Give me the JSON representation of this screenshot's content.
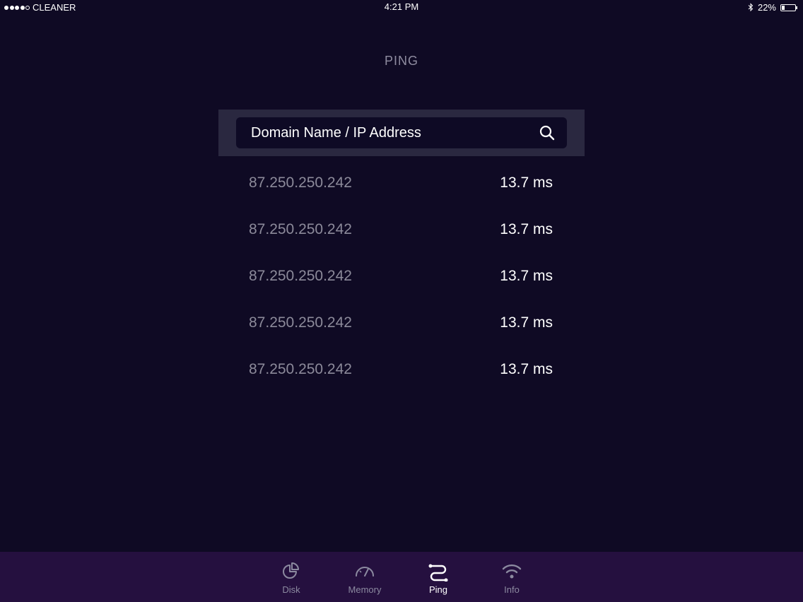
{
  "status_bar": {
    "carrier": "CLEANER",
    "time": "4:21 PM",
    "battery_percent": "22%",
    "battery_level": 0.22,
    "signal_bars_filled": 4,
    "signal_bars_total": 5,
    "icons": [
      "signal-dots-icon",
      "bluetooth-icon",
      "battery-icon"
    ]
  },
  "header": {
    "title": "PING"
  },
  "search": {
    "placeholder": "Domain Name / IP Address",
    "value": "",
    "icon": "search-icon"
  },
  "results": [
    {
      "ip": "87.250.250.242",
      "time": "13.7 ms"
    },
    {
      "ip": "87.250.250.242",
      "time": "13.7 ms"
    },
    {
      "ip": "87.250.250.242",
      "time": "13.7 ms"
    },
    {
      "ip": "87.250.250.242",
      "time": "13.7 ms"
    },
    {
      "ip": "87.250.250.242",
      "time": "13.7 ms"
    }
  ],
  "tabs": [
    {
      "label": "Disk",
      "icon": "disk-pie-icon",
      "active": false
    },
    {
      "label": "Memory",
      "icon": "speedometer-icon",
      "active": false
    },
    {
      "label": "Ping",
      "icon": "ping-route-icon",
      "active": true
    },
    {
      "label": "Info",
      "icon": "wifi-icon",
      "active": false
    }
  ],
  "colors": {
    "background": "#0f0a24",
    "tab_bar": "#25103f",
    "search_panel": "#2a2840",
    "muted_text": "#8c8a9a",
    "accent_active": "#ffffff"
  }
}
